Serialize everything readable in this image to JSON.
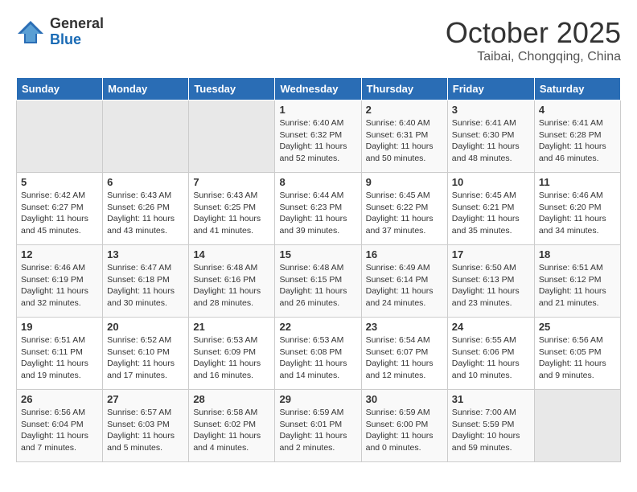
{
  "header": {
    "logo_general": "General",
    "logo_blue": "Blue",
    "title": "October 2025",
    "subtitle": "Taibai, Chongqing, China"
  },
  "days_of_week": [
    "Sunday",
    "Monday",
    "Tuesday",
    "Wednesday",
    "Thursday",
    "Friday",
    "Saturday"
  ],
  "weeks": [
    [
      {
        "day": "",
        "info": ""
      },
      {
        "day": "",
        "info": ""
      },
      {
        "day": "",
        "info": ""
      },
      {
        "day": "1",
        "info": "Sunrise: 6:40 AM\nSunset: 6:32 PM\nDaylight: 11 hours\nand 52 minutes."
      },
      {
        "day": "2",
        "info": "Sunrise: 6:40 AM\nSunset: 6:31 PM\nDaylight: 11 hours\nand 50 minutes."
      },
      {
        "day": "3",
        "info": "Sunrise: 6:41 AM\nSunset: 6:30 PM\nDaylight: 11 hours\nand 48 minutes."
      },
      {
        "day": "4",
        "info": "Sunrise: 6:41 AM\nSunset: 6:28 PM\nDaylight: 11 hours\nand 46 minutes."
      }
    ],
    [
      {
        "day": "5",
        "info": "Sunrise: 6:42 AM\nSunset: 6:27 PM\nDaylight: 11 hours\nand 45 minutes."
      },
      {
        "day": "6",
        "info": "Sunrise: 6:43 AM\nSunset: 6:26 PM\nDaylight: 11 hours\nand 43 minutes."
      },
      {
        "day": "7",
        "info": "Sunrise: 6:43 AM\nSunset: 6:25 PM\nDaylight: 11 hours\nand 41 minutes."
      },
      {
        "day": "8",
        "info": "Sunrise: 6:44 AM\nSunset: 6:23 PM\nDaylight: 11 hours\nand 39 minutes."
      },
      {
        "day": "9",
        "info": "Sunrise: 6:45 AM\nSunset: 6:22 PM\nDaylight: 11 hours\nand 37 minutes."
      },
      {
        "day": "10",
        "info": "Sunrise: 6:45 AM\nSunset: 6:21 PM\nDaylight: 11 hours\nand 35 minutes."
      },
      {
        "day": "11",
        "info": "Sunrise: 6:46 AM\nSunset: 6:20 PM\nDaylight: 11 hours\nand 34 minutes."
      }
    ],
    [
      {
        "day": "12",
        "info": "Sunrise: 6:46 AM\nSunset: 6:19 PM\nDaylight: 11 hours\nand 32 minutes."
      },
      {
        "day": "13",
        "info": "Sunrise: 6:47 AM\nSunset: 6:18 PM\nDaylight: 11 hours\nand 30 minutes."
      },
      {
        "day": "14",
        "info": "Sunrise: 6:48 AM\nSunset: 6:16 PM\nDaylight: 11 hours\nand 28 minutes."
      },
      {
        "day": "15",
        "info": "Sunrise: 6:48 AM\nSunset: 6:15 PM\nDaylight: 11 hours\nand 26 minutes."
      },
      {
        "day": "16",
        "info": "Sunrise: 6:49 AM\nSunset: 6:14 PM\nDaylight: 11 hours\nand 24 minutes."
      },
      {
        "day": "17",
        "info": "Sunrise: 6:50 AM\nSunset: 6:13 PM\nDaylight: 11 hours\nand 23 minutes."
      },
      {
        "day": "18",
        "info": "Sunrise: 6:51 AM\nSunset: 6:12 PM\nDaylight: 11 hours\nand 21 minutes."
      }
    ],
    [
      {
        "day": "19",
        "info": "Sunrise: 6:51 AM\nSunset: 6:11 PM\nDaylight: 11 hours\nand 19 minutes."
      },
      {
        "day": "20",
        "info": "Sunrise: 6:52 AM\nSunset: 6:10 PM\nDaylight: 11 hours\nand 17 minutes."
      },
      {
        "day": "21",
        "info": "Sunrise: 6:53 AM\nSunset: 6:09 PM\nDaylight: 11 hours\nand 16 minutes."
      },
      {
        "day": "22",
        "info": "Sunrise: 6:53 AM\nSunset: 6:08 PM\nDaylight: 11 hours\nand 14 minutes."
      },
      {
        "day": "23",
        "info": "Sunrise: 6:54 AM\nSunset: 6:07 PM\nDaylight: 11 hours\nand 12 minutes."
      },
      {
        "day": "24",
        "info": "Sunrise: 6:55 AM\nSunset: 6:06 PM\nDaylight: 11 hours\nand 10 minutes."
      },
      {
        "day": "25",
        "info": "Sunrise: 6:56 AM\nSunset: 6:05 PM\nDaylight: 11 hours\nand 9 minutes."
      }
    ],
    [
      {
        "day": "26",
        "info": "Sunrise: 6:56 AM\nSunset: 6:04 PM\nDaylight: 11 hours\nand 7 minutes."
      },
      {
        "day": "27",
        "info": "Sunrise: 6:57 AM\nSunset: 6:03 PM\nDaylight: 11 hours\nand 5 minutes."
      },
      {
        "day": "28",
        "info": "Sunrise: 6:58 AM\nSunset: 6:02 PM\nDaylight: 11 hours\nand 4 minutes."
      },
      {
        "day": "29",
        "info": "Sunrise: 6:59 AM\nSunset: 6:01 PM\nDaylight: 11 hours\nand 2 minutes."
      },
      {
        "day": "30",
        "info": "Sunrise: 6:59 AM\nSunset: 6:00 PM\nDaylight: 11 hours\nand 0 minutes."
      },
      {
        "day": "31",
        "info": "Sunrise: 7:00 AM\nSunset: 5:59 PM\nDaylight: 10 hours\nand 59 minutes."
      },
      {
        "day": "",
        "info": ""
      }
    ]
  ]
}
